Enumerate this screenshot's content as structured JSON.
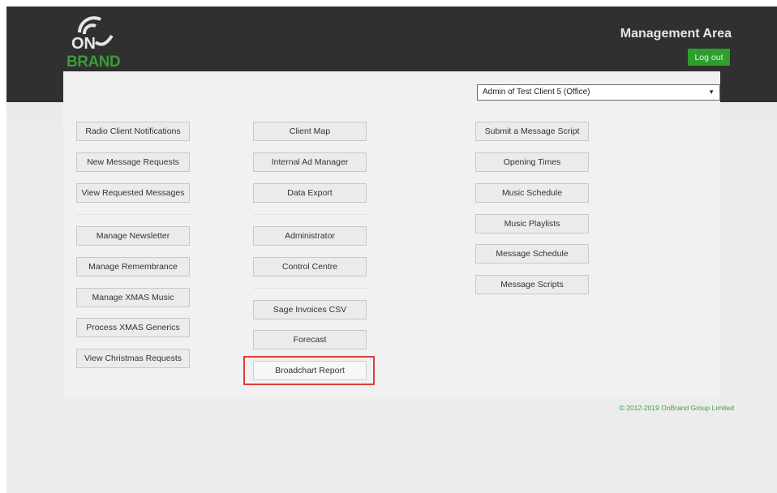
{
  "header": {
    "logo_text": "ON BRAND",
    "title": "Management Area",
    "logout_label": "Log out"
  },
  "client_select": {
    "value": "Admin of Test Client 5 (Office)"
  },
  "column1": [
    "Radio Client Notifications",
    "New Message Requests",
    "View Requested Messages",
    "Manage Newsletter",
    "Manage Remembrance",
    "Manage XMAS Music",
    "Process XMAS Generics",
    "View Christmas Requests"
  ],
  "column2": [
    "Client Map",
    "Internal Ad Manager",
    "Data Export",
    "Administrator",
    "Control Centre",
    "Sage Invoices CSV",
    "Forecast",
    "Broadchart Report"
  ],
  "column3": [
    "Submit a Message Script",
    "Opening Times",
    "Music Schedule",
    "Music Playlists",
    "Message Schedule",
    "Message Scripts"
  ],
  "footer": {
    "copyright": "© 2012-2019 OnBrand Group Limited"
  },
  "colors": {
    "header_bg": "#303030",
    "accent_green": "#2c9f2c",
    "highlight_red": "#e23b3b"
  }
}
